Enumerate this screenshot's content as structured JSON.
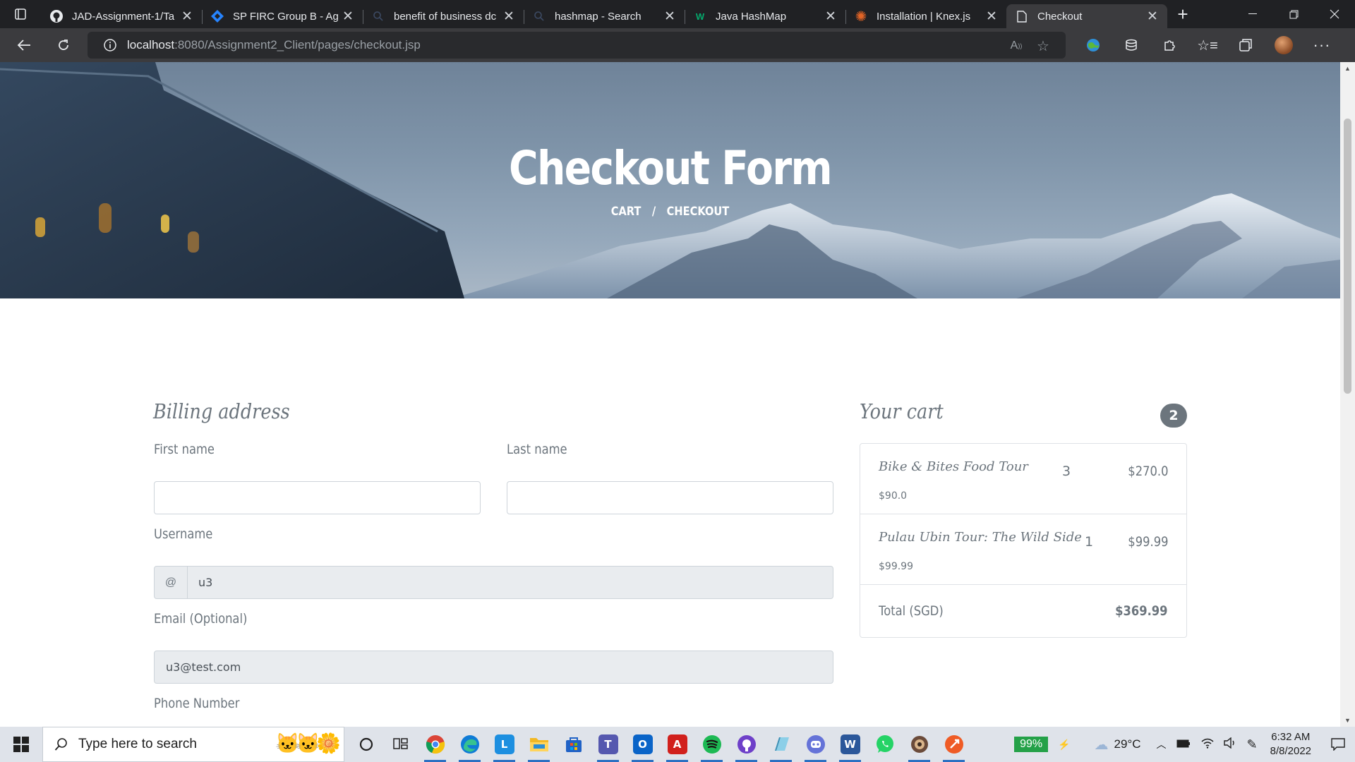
{
  "browser": {
    "tabs": [
      {
        "title": "JAD-Assignment-1/Ta",
        "icon": "github-icon",
        "active": false
      },
      {
        "title": "SP FIRC Group B - Ag",
        "icon": "jira-icon",
        "active": false
      },
      {
        "title": "benefit of business dc",
        "icon": "search-icon",
        "active": false
      },
      {
        "title": "hashmap - Search",
        "icon": "search-icon",
        "active": false
      },
      {
        "title": "Java HashMap",
        "icon": "w3schools-icon",
        "active": false
      },
      {
        "title": "Installation | Knex.js",
        "icon": "knex-icon",
        "active": false
      },
      {
        "title": "Checkout",
        "icon": "page-icon",
        "active": true
      }
    ],
    "address": {
      "host": "localhost",
      "path": ":8080/Assignment2_Client/pages/checkout.jsp"
    }
  },
  "hero": {
    "title": "Checkout Form",
    "breadcrumb": [
      "CART",
      "/",
      "CHECKOUT"
    ]
  },
  "billing": {
    "heading": "Billing address",
    "first_name_label": "First name",
    "first_name_value": "",
    "last_name_label": "Last name",
    "last_name_value": "",
    "username_label": "Username",
    "username_prefix": "@",
    "username_value": "u3",
    "email_label": "Email (Optional)",
    "email_value": "u3@test.com",
    "phone_label": "Phone Number"
  },
  "cart": {
    "heading": "Your cart",
    "count": "2",
    "items": [
      {
        "name": "Bike & Bites Food Tour",
        "unit_price": "$90.0",
        "qty": "3",
        "price": "$270.0"
      },
      {
        "name": "Pulau Ubin Tour: The Wild Side",
        "unit_price": "$99.99",
        "qty": "1",
        "price": "$99.99"
      }
    ],
    "total_label": "Total (SGD)",
    "total_value": "$369.99"
  },
  "taskbar": {
    "search_placeholder": "Type here to search",
    "battery": "99%",
    "temperature": "29°C",
    "time": "6:32 AM",
    "date": "8/8/2022",
    "apps": [
      {
        "name": "cortana-icon",
        "color": "#202020"
      },
      {
        "name": "task-view-icon",
        "color": "#202020"
      },
      {
        "name": "chrome-icon",
        "color": "#db4437"
      },
      {
        "name": "edge-icon",
        "color": "#0f7bd6"
      },
      {
        "name": "lightshot-icon",
        "color": "#1d8fe0"
      },
      {
        "name": "file-explorer-icon",
        "color": "#f2b824"
      },
      {
        "name": "store-icon",
        "color": "#2062c6"
      },
      {
        "name": "teams-icon",
        "color": "#5558af"
      },
      {
        "name": "outlook-icon",
        "color": "#0a64c8"
      },
      {
        "name": "acrobat-icon",
        "color": "#d1201c"
      },
      {
        "name": "spotify-icon",
        "color": "#1db954"
      },
      {
        "name": "github-desktop-icon",
        "color": "#6e40c9"
      },
      {
        "name": "notepad-icon",
        "color": "#5aa5c8"
      },
      {
        "name": "discord-icon",
        "color": "#6573d8"
      },
      {
        "name": "word-icon",
        "color": "#2b579a"
      },
      {
        "name": "whatsapp-icon",
        "color": "#25d366"
      },
      {
        "name": "app-icon",
        "color": "#6b4b3a"
      },
      {
        "name": "postman-icon",
        "color": "#ef5b25"
      }
    ]
  }
}
